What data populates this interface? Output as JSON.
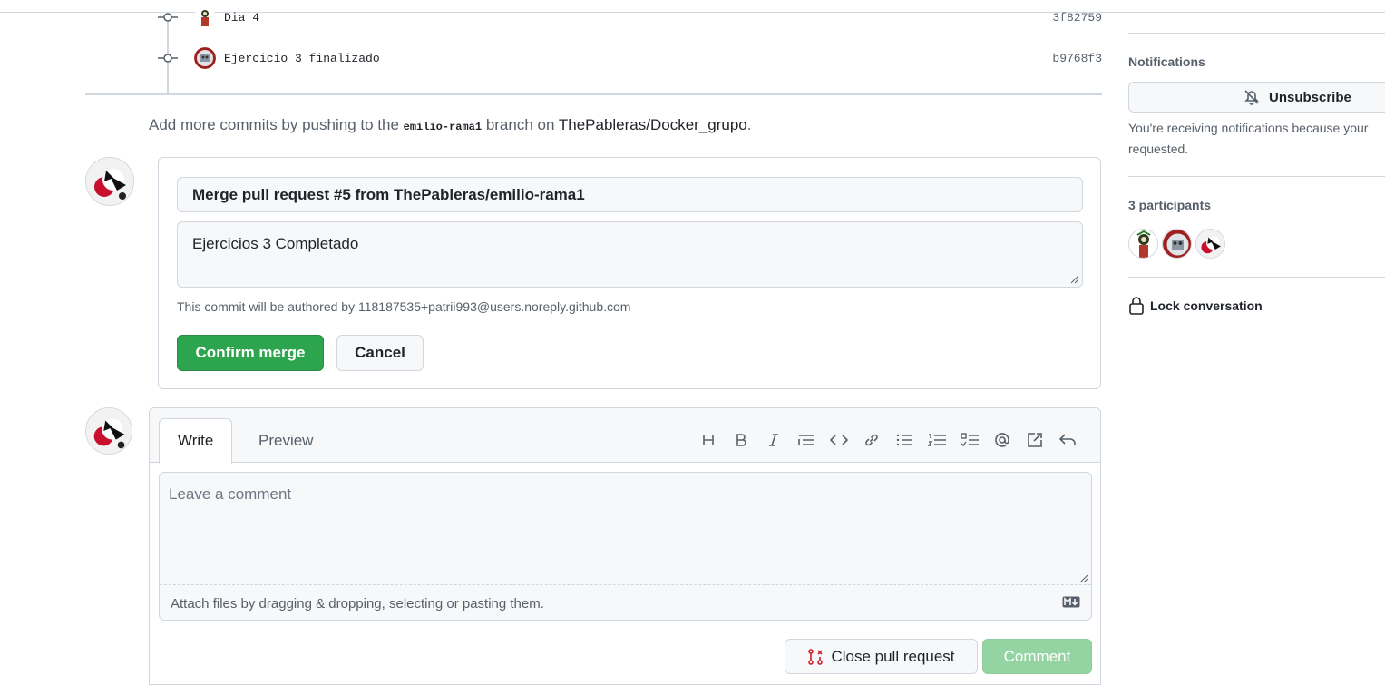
{
  "commits": [
    {
      "message": "Dia 4",
      "sha": "3f82759"
    },
    {
      "message": "Ejercicio 3 finalizado",
      "sha": "b9768f3"
    }
  ],
  "hint": {
    "prefix": "Add more commits by pushing to the",
    "branch": "emilio-rama1",
    "middle": "branch on",
    "repo": "ThePableras/Docker_grupo",
    "suffix": "."
  },
  "merge": {
    "title_value": "Merge pull request #5 from ThePableras/emilio-rama1",
    "body_value": "Ejercicios 3 Completado",
    "author_note": "This commit will be authored by 118187535+patrii993@users.noreply.github.com",
    "confirm_label": "Confirm merge",
    "cancel_label": "Cancel"
  },
  "comment": {
    "tab_write": "Write",
    "tab_preview": "Preview",
    "placeholder": "Leave a comment",
    "attach_text": "Attach files by dragging & dropping, selecting or pasting them.",
    "close_pr_label": "Close pull request",
    "comment_label": "Comment",
    "toolbar_icons": [
      "heading-icon",
      "bold-icon",
      "italic-icon",
      "quote-icon",
      "code-icon",
      "link-icon",
      "unordered-list-icon",
      "ordered-list-icon",
      "task-list-icon",
      "mention-icon",
      "cross-reference-icon",
      "reply-icon"
    ]
  },
  "sidebar": {
    "notifications_heading": "Notifications",
    "unsubscribe_label": "Unsubscribe",
    "notification_text_line1": "You're receiving notifications because your",
    "notification_text_line2": "requested.",
    "participants_heading": "3 participants",
    "lock_label": "Lock conversation"
  },
  "colors": {
    "confirm_green": "#2da44e",
    "comment_disabled_green": "#94d3a2",
    "close_pr_icon_red": "#cf222e"
  }
}
